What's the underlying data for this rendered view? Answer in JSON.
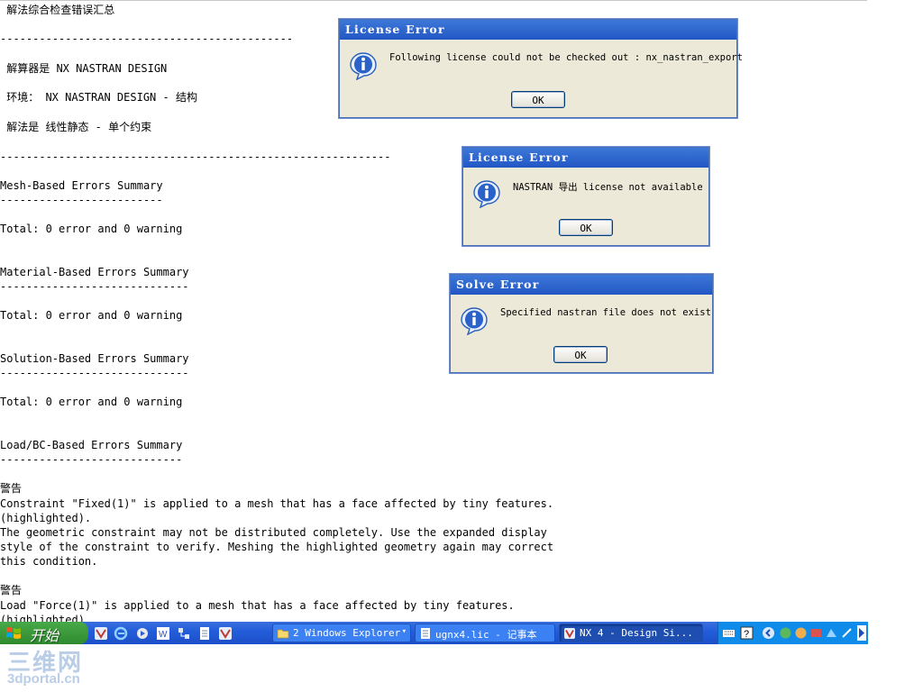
{
  "report": {
    "lines": [
      " 解法综合检查错误汇总",
      "---------------------------------------------",
      " 解算器是 NX NASTRAN DESIGN",
      " 环境： NX NASTRAN DESIGN - 结构",
      " 解法是 线性静态 - 单个约束",
      "------------------------------------------------------------",
      "Mesh-Based Errors Summary",
      "-------------------------",
      "Total: 0 error and 0 warning",
      "Material-Based Errors Summary",
      "-----------------------------",
      "Total: 0 error and 0 warning",
      "Solution-Based Errors Summary",
      "-----------------------------",
      "Total: 0 error and 0 warning",
      "Load/BC-Based Errors Summary",
      "----------------------------",
      "警告",
      "Constraint \"Fixed(1)\" is applied to a mesh that has a face affected by tiny features.",
      "(highlighted).",
      "The geometric constraint may not be distributed completely. Use the expanded display",
      "style of the constraint to verify. Meshing the highlighted geometry again may correct",
      "this condition.",
      "警告",
      "Load \"Force(1)\" is applied to a mesh that has a face affected by tiny features.",
      "(highlighted)."
    ]
  },
  "dialogs": [
    {
      "title": "License Error",
      "message": "Following license could not be checked out : nx_nastran_export",
      "ok_label": "OK",
      "icon": "info-icon"
    },
    {
      "title": "License Error",
      "message": "NASTRAN 导出 license not available",
      "ok_label": "OK",
      "icon": "info-icon"
    },
    {
      "title": "Solve Error",
      "message": "Specified nastran file does not exist",
      "ok_label": "OK",
      "icon": "info-icon"
    }
  ],
  "taskbar": {
    "start_label": "开始",
    "quick_launch": [
      "nx-icon",
      "ie-icon",
      "media-icon",
      "word-icon",
      "network-icon",
      "notepad-icon",
      "nx-icon"
    ],
    "tasks": [
      {
        "label": "2 Windows Explorer",
        "icon": "folder-icon",
        "active": false
      },
      {
        "label": "ugnx4.lic - 记事本",
        "icon": "notepad-icon",
        "active": false
      },
      {
        "label": "NX 4 - Design Si...",
        "icon": "nx-icon",
        "active": true
      }
    ],
    "tray_icons": [
      "keyboard-icon",
      "help-icon",
      "arrow-icon",
      "tray-app-icon",
      "tray-app-icon",
      "tray-app-icon",
      "tray-app-icon",
      "tray-app-icon"
    ]
  },
  "watermark": {
    "logo": "三维网",
    "site": "3dportal.cn"
  },
  "colors": {
    "titlebar": "#2257c4",
    "dialog_bg": "#ece9d8",
    "taskbar": "#245edb",
    "start": "#3c9a3c",
    "tray": "#0f8ce9",
    "watermark": "#b9cde6"
  }
}
